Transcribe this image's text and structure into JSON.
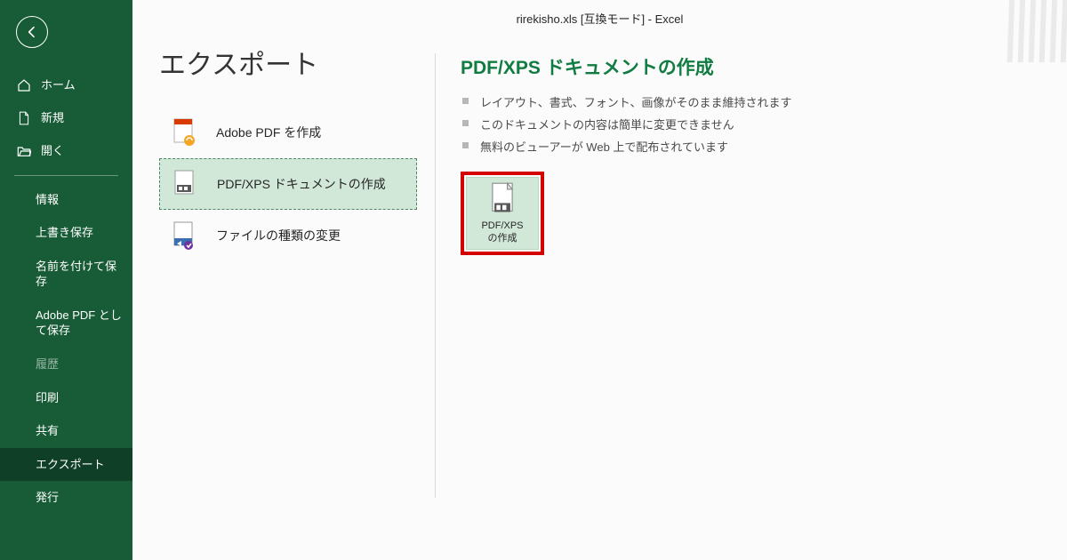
{
  "window": {
    "title": "rirekisho.xls  [互換モード]  -  Excel"
  },
  "sidebar": {
    "primary": [
      {
        "id": "home",
        "label": "ホーム"
      },
      {
        "id": "new",
        "label": "新規"
      },
      {
        "id": "open",
        "label": "開く"
      }
    ],
    "secondary": [
      {
        "id": "info",
        "label": "情報"
      },
      {
        "id": "save",
        "label": "上書き保存"
      },
      {
        "id": "saveas",
        "label": "名前を付けて保存"
      },
      {
        "id": "adobe",
        "label": "Adobe PDF として保存"
      },
      {
        "id": "history",
        "label": "履歴",
        "muted": true
      },
      {
        "id": "print",
        "label": "印刷"
      },
      {
        "id": "share",
        "label": "共有"
      },
      {
        "id": "export",
        "label": "エクスポート",
        "active": true
      },
      {
        "id": "publish",
        "label": "発行"
      }
    ]
  },
  "page": {
    "title": "エクスポート",
    "options": [
      {
        "id": "adobe-pdf",
        "label": "Adobe PDF を作成",
        "selected": false
      },
      {
        "id": "pdf-xps",
        "label": "PDF/XPS ドキュメントの作成",
        "selected": true
      },
      {
        "id": "change-type",
        "label": "ファイルの種類の変更",
        "selected": false
      }
    ]
  },
  "detail": {
    "title": "PDF/XPS ドキュメントの作成",
    "bullets": [
      "レイアウト、書式、フォント、画像がそのまま維持されます",
      "このドキュメントの内容は簡単に変更できません",
      "無料のビューアーが Web 上で配布されています"
    ],
    "action_label": "PDF/XPS\nの作成"
  }
}
